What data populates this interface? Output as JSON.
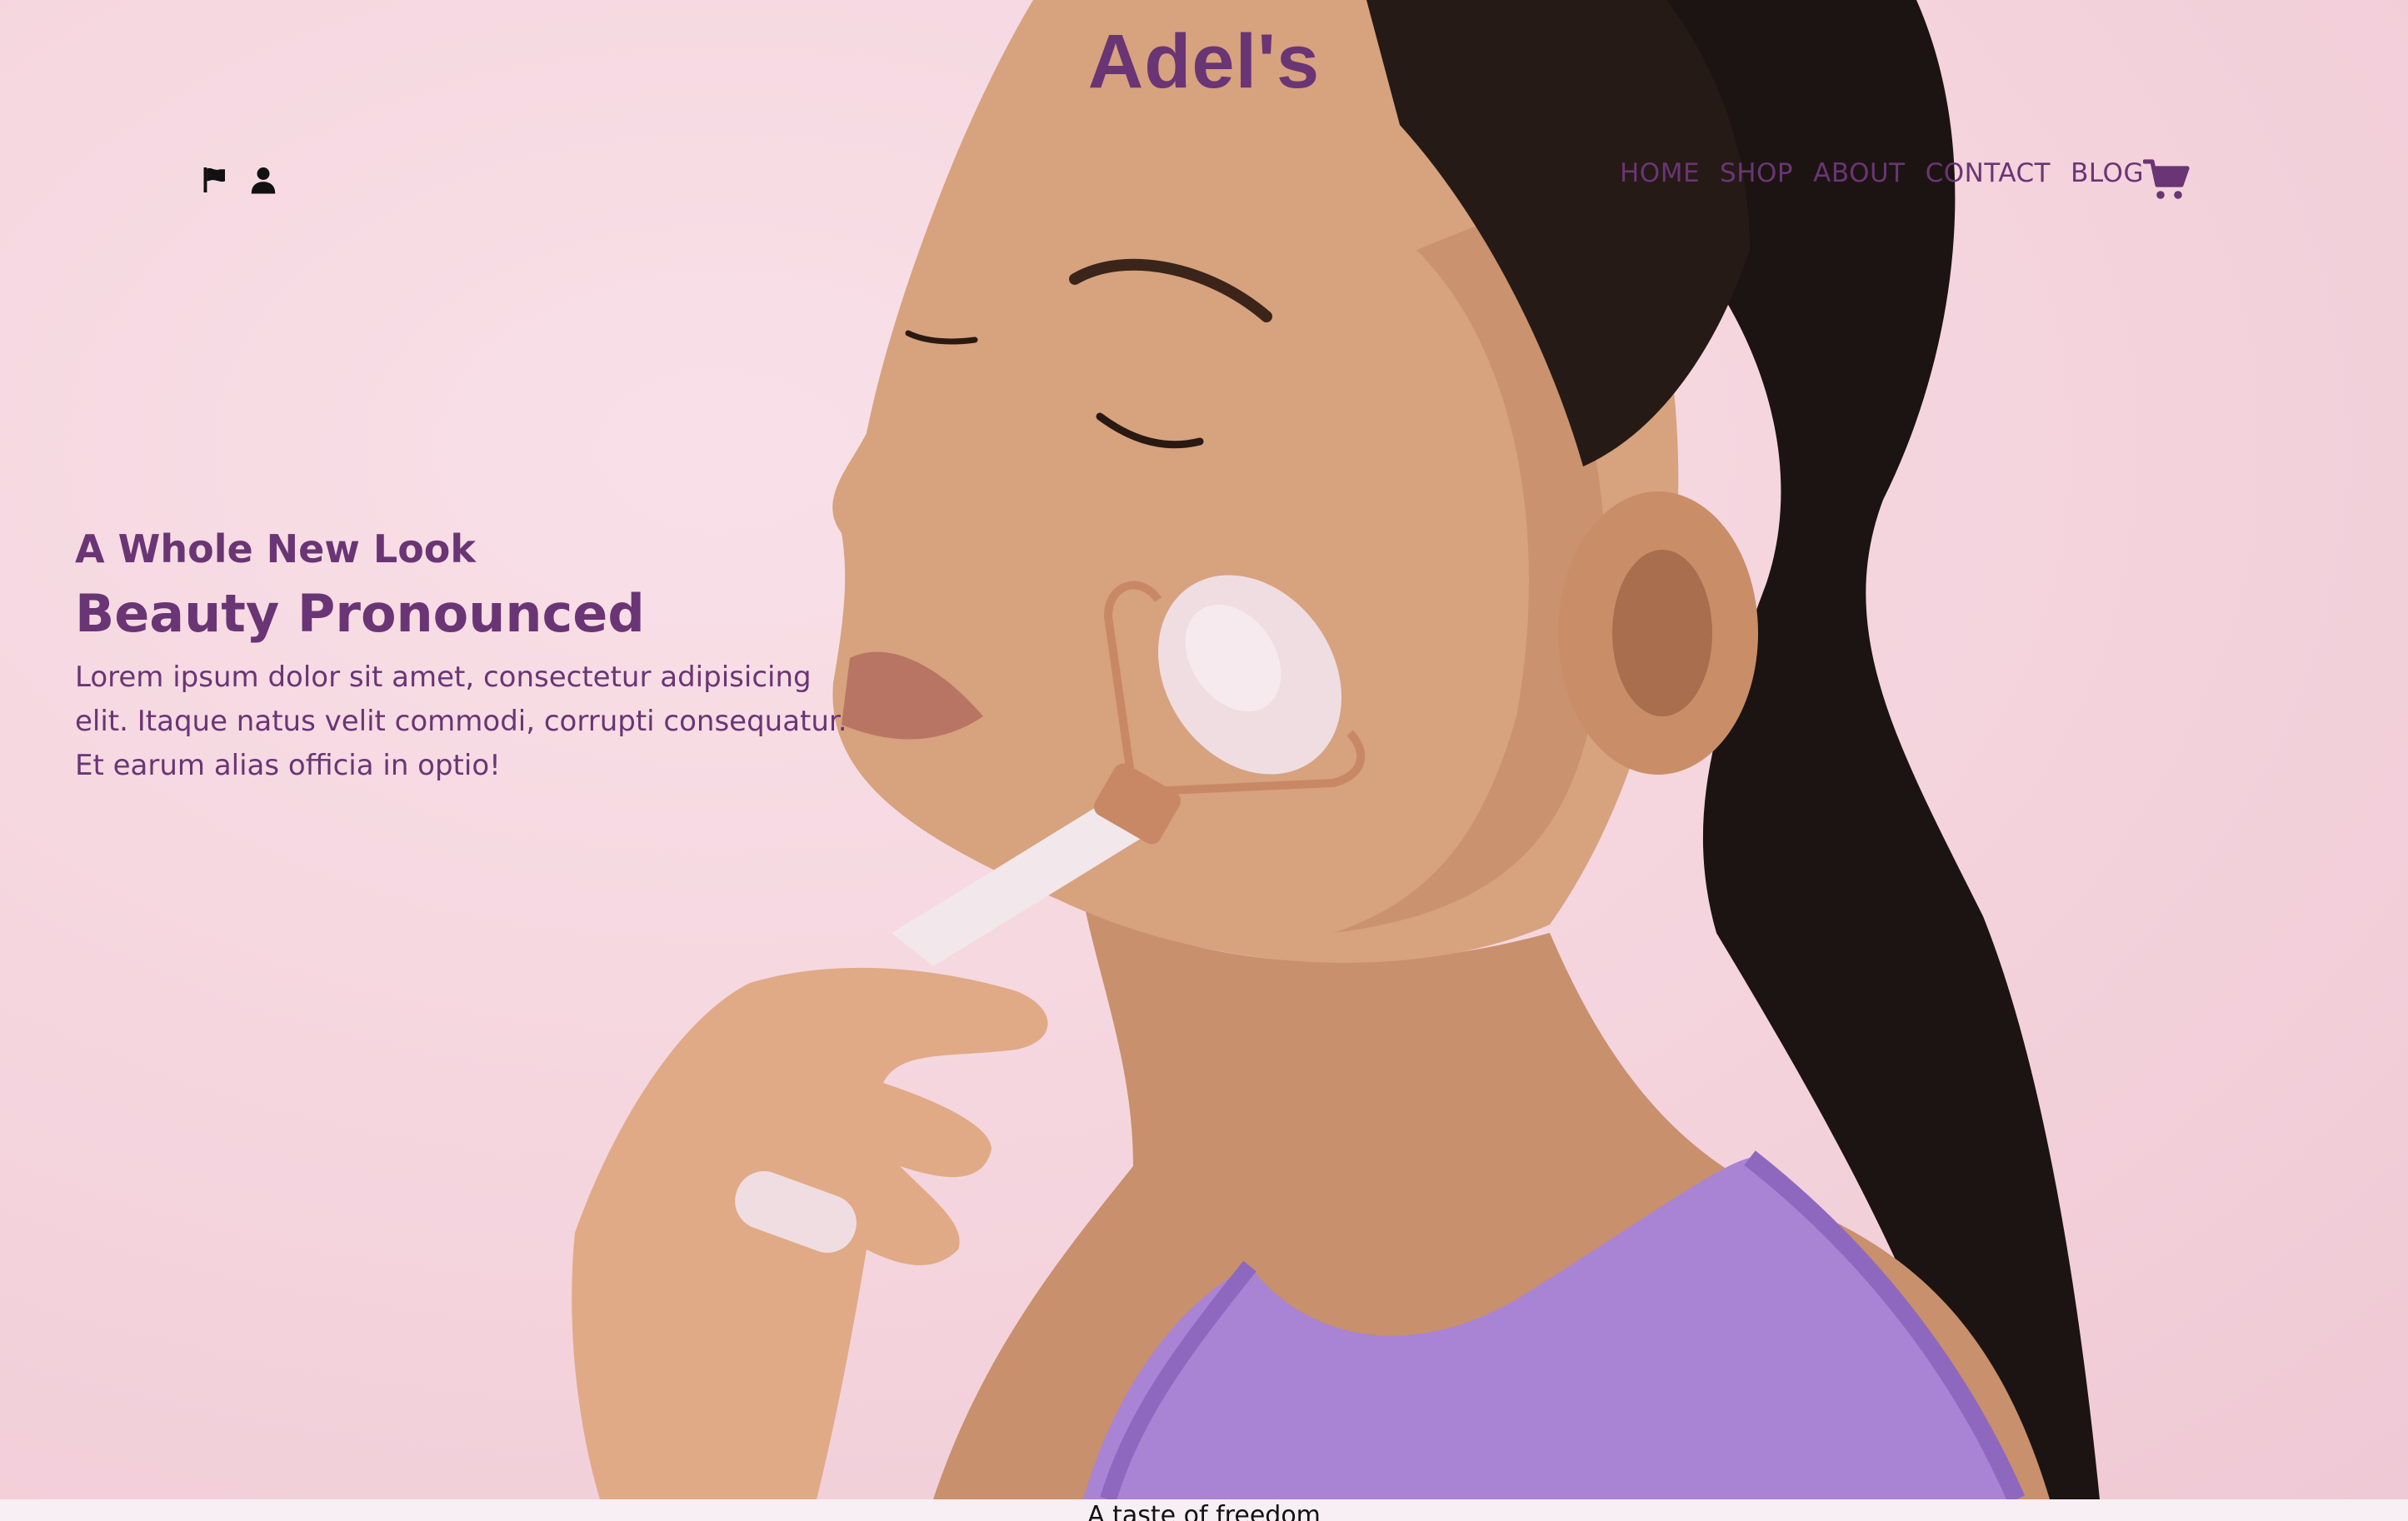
{
  "brand": {
    "name": "Adel's"
  },
  "top_icons": [
    "flag-icon",
    "user-icon"
  ],
  "nav": {
    "items": [
      "HOME",
      "SHOP",
      "ABOUT",
      "CONTACT",
      "BLOG"
    ],
    "cart_icon": "cart-icon"
  },
  "hero": {
    "subtitle": "A Whole New Look",
    "title": "Beauty Pronounced",
    "description": "Lorem ipsum dolor sit amet, consectetur adipisicing elit. Itaque natus velit commodi, corrupti consequatur. Et earum alias officia in optio!"
  },
  "footer": {
    "tagline": "A taste of freedom"
  },
  "colors": {
    "accent": "#6a3574",
    "background": "#f6dae3"
  }
}
